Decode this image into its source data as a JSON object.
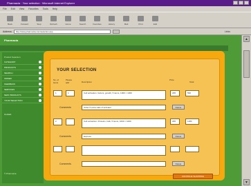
{
  "window": {
    "title": "Pharmacia · Your selection · Microsoft Internet Explorer"
  },
  "menu": [
    "File",
    "Edit",
    "View",
    "Favorites",
    "Tools",
    "Help"
  ],
  "toolbar": [
    "Back",
    "Forward",
    "Stop",
    "Refresh",
    "Home",
    "Search",
    "Favorites",
    "History",
    "Mail",
    "Print",
    "Edit"
  ],
  "address": {
    "label": "Address",
    "url": "http://www.pharmacia.com/selection.asp",
    "links": "Links"
  },
  "site": {
    "logo": "Pharmacia"
  },
  "sidebar": {
    "heading": "Product Selection",
    "items": [
      "CATEGORY",
      "PRODUCTS",
      "SEARCH",
      "ORDER",
      "FEEDBACK",
      "SERVICES",
      "NEW PRODUCTS",
      "YOUR SELECTION"
    ],
    "lone": "Contact",
    "footer": "© Pharmacia"
  },
  "selection": {
    "title": "YOUR SELECTION",
    "columns": {
      "qty": "No. of items",
      "plus": "Please add",
      "description": "Description",
      "price": "Price",
      "total": "Total"
    },
    "rows": [
      {
        "qty": "1",
        "plus": "1",
        "description": "Cell activation, factors, growth, 5 items, 1000 × 1000",
        "comment_label": "Comments",
        "comment": "Order 5 extra vials of activator",
        "price": "295",
        "total": "590",
        "button": "Delete"
      },
      {
        "qty": "2",
        "plus": "",
        "description": "Cell extraction: Proteins, bulk, 5 items, 1000 × 1000",
        "comment_label": "Comments",
        "comment": "Express",
        "price": "295",
        "total": "1180",
        "button": "Delete"
      },
      {
        "qty": "",
        "plus": "",
        "description": "",
        "comment_label": "Comments",
        "comment": "",
        "price": "",
        "total": "",
        "button": "Delete"
      }
    ],
    "submit": "CONTINUE SHOPPING"
  }
}
